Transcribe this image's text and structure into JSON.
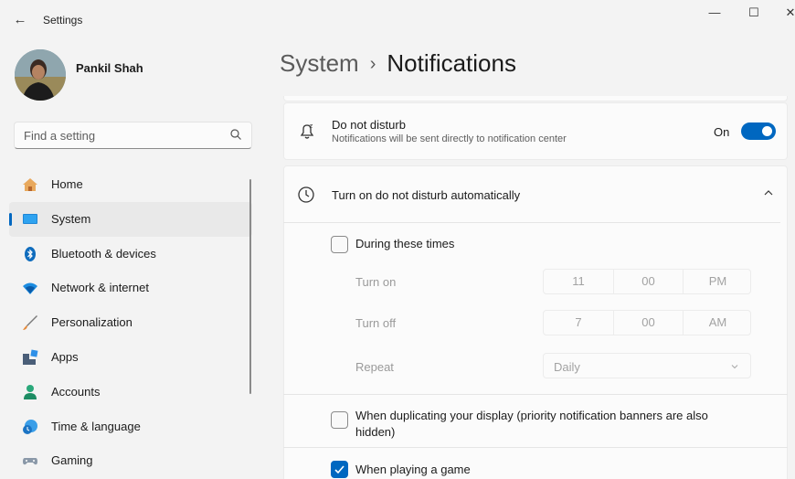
{
  "window": {
    "title": "Settings",
    "back_glyph": "←",
    "min_glyph": "—",
    "max_glyph": "☐",
    "close_glyph": "✕"
  },
  "user": {
    "name": "Pankil Shah"
  },
  "search": {
    "placeholder": "Find a setting"
  },
  "sidebar": {
    "items": [
      {
        "label": "Home",
        "icon": "home-icon",
        "active": false
      },
      {
        "label": "System",
        "icon": "system-icon",
        "active": true
      },
      {
        "label": "Bluetooth & devices",
        "icon": "bluetooth-icon",
        "active": false
      },
      {
        "label": "Network & internet",
        "icon": "wifi-icon",
        "active": false
      },
      {
        "label": "Personalization",
        "icon": "brush-icon",
        "active": false
      },
      {
        "label": "Apps",
        "icon": "apps-icon",
        "active": false
      },
      {
        "label": "Accounts",
        "icon": "accounts-icon",
        "active": false
      },
      {
        "label": "Time & language",
        "icon": "time-language-icon",
        "active": false
      },
      {
        "label": "Gaming",
        "icon": "gaming-icon",
        "active": false
      }
    ]
  },
  "header": {
    "crumb": "System",
    "separator": "›",
    "title": "Notifications"
  },
  "dnd": {
    "title": "Do not disturb",
    "subtitle": "Notifications will be sent directly to notification center",
    "toggle_label": "On",
    "toggle_on": true
  },
  "auto": {
    "title": "Turn on do not disturb automatically",
    "during_label": "During these times",
    "during_checked": false,
    "turn_on": {
      "label": "Turn on",
      "hour": "11",
      "minute": "00",
      "period": "PM"
    },
    "turn_off": {
      "label": "Turn off",
      "hour": "7",
      "minute": "00",
      "period": "AM"
    },
    "repeat": {
      "label": "Repeat",
      "value": "Daily"
    },
    "duplicating": {
      "label_line1": "When duplicating your display (priority notification banners are also",
      "label_line2": "hidden)",
      "checked": false
    },
    "game": {
      "label": "When playing a game",
      "checked": true
    }
  },
  "colors": {
    "accent": "#0067c0",
    "background": "#f3f3f3",
    "card": "#fbfbfb"
  }
}
